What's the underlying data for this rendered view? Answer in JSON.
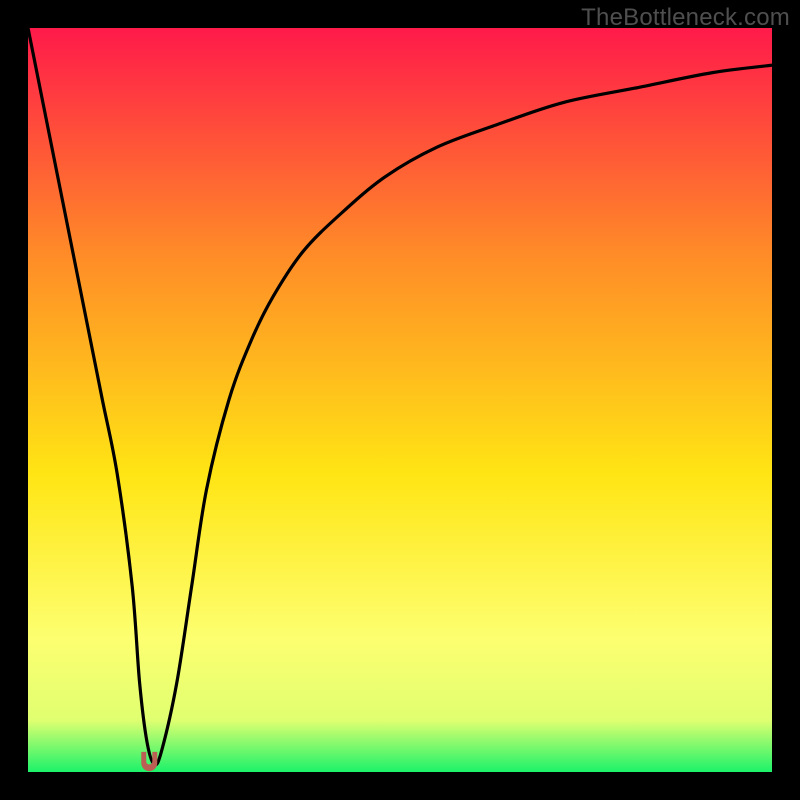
{
  "watermark": "TheBottleneck.com",
  "colors": {
    "background": "#000000",
    "curve": "#000000",
    "marker": "#bb5e53",
    "gradient_top": "#ff1a4a",
    "gradient_mid1": "#ff8a28",
    "gradient_mid2": "#ffe514",
    "gradient_mid3": "#fdff70",
    "gradient_band": "#e0ff70",
    "gradient_bottom": "#1cf26a"
  },
  "chart_data": {
    "type": "line",
    "title": "",
    "xlabel": "",
    "ylabel": "",
    "xlim": [
      0,
      100
    ],
    "ylim": [
      0,
      100
    ],
    "series": [
      {
        "name": "bottleneck-curve",
        "x": [
          0,
          2,
          4,
          6,
          8,
          10,
          12,
          14,
          15,
          16,
          17,
          18,
          20,
          22,
          24,
          27,
          30,
          33,
          37,
          42,
          48,
          55,
          63,
          72,
          82,
          92,
          100
        ],
        "values": [
          100,
          90,
          80,
          70,
          60,
          50,
          40,
          25,
          12,
          4,
          1,
          3,
          12,
          25,
          38,
          50,
          58,
          64,
          70,
          75,
          80,
          84,
          87,
          90,
          92,
          94,
          95
        ]
      }
    ],
    "annotations": [
      {
        "name": "optimal-marker",
        "x": 16.3,
        "y": 1.2
      }
    ]
  }
}
